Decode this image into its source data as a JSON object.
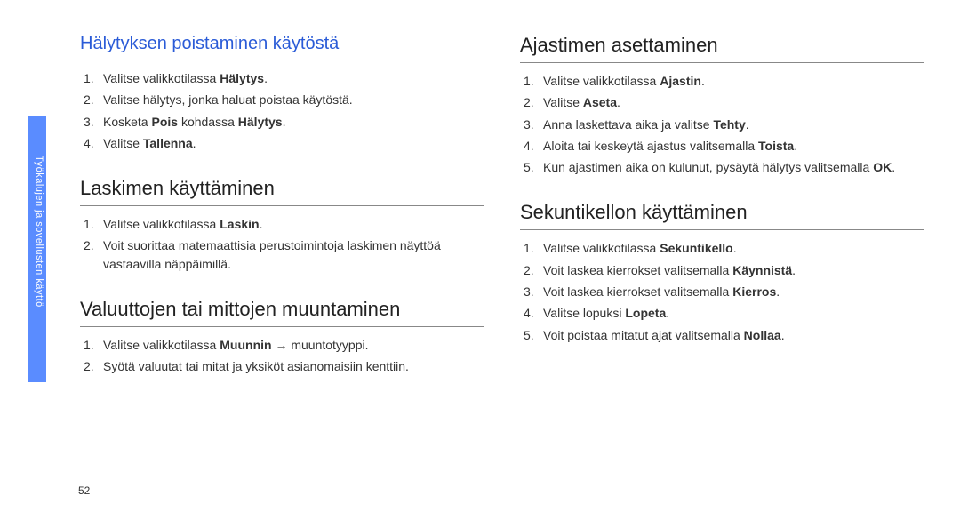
{
  "sidebar": {
    "label": "Työkalujen ja sovellusten käyttö"
  },
  "pageNumber": "52",
  "left": {
    "sec1": {
      "title": "Hälytyksen poistaminen käytöstä",
      "s1a": "Valitse valikkotilassa ",
      "s1b": "Hälytys",
      "s1c": ".",
      "s2": "Valitse hälytys, jonka haluat poistaa käytöstä.",
      "s3a": "Kosketa ",
      "s3b": "Pois",
      "s3c": " kohdassa ",
      "s3d": "Hälytys",
      "s3e": ".",
      "s4a": "Valitse ",
      "s4b": "Tallenna",
      "s4c": "."
    },
    "sec2": {
      "title": "Laskimen käyttäminen",
      "s1a": "Valitse valikkotilassa ",
      "s1b": "Laskin",
      "s1c": ".",
      "s2": "Voit suorittaa matemaattisia perustoimintoja laskimen näyttöä vastaavilla näppäimillä."
    },
    "sec3": {
      "title": "Valuuttojen tai mittojen muuntaminen",
      "s1a": "Valitse valikkotilassa ",
      "s1b": "Muunnin",
      "s1c": " → muuntotyyppi.",
      "s2": "Syötä valuutat tai mitat ja yksiköt asianomaisiin kenttiin."
    }
  },
  "right": {
    "sec1": {
      "title": "Ajastimen asettaminen",
      "s1a": "Valitse valikkotilassa ",
      "s1b": "Ajastin",
      "s1c": ".",
      "s2a": "Valitse ",
      "s2b": "Aseta",
      "s2c": ".",
      "s3a": "Anna laskettava aika ja valitse ",
      "s3b": "Tehty",
      "s3c": ".",
      "s4a": "Aloita tai keskeytä ajastus valitsemalla ",
      "s4b": "Toista",
      "s4c": ".",
      "s5a": "Kun ajastimen aika on kulunut, pysäytä hälytys valitsemalla ",
      "s5b": "OK",
      "s5c": "."
    },
    "sec2": {
      "title": "Sekuntikellon käyttäminen",
      "s1a": "Valitse valikkotilassa ",
      "s1b": "Sekuntikello",
      "s1c": ".",
      "s2a": "Voit laskea kierrokset valitsemalla ",
      "s2b": "Käynnistä",
      "s2c": ".",
      "s3a": "Voit laskea kierrokset valitsemalla ",
      "s3b": "Kierros",
      "s3c": ".",
      "s4a": "Valitse lopuksi ",
      "s4b": "Lopeta",
      "s4c": ".",
      "s5a": "Voit poistaa mitatut ajat valitsemalla ",
      "s5b": "Nollaa",
      "s5c": "."
    }
  }
}
